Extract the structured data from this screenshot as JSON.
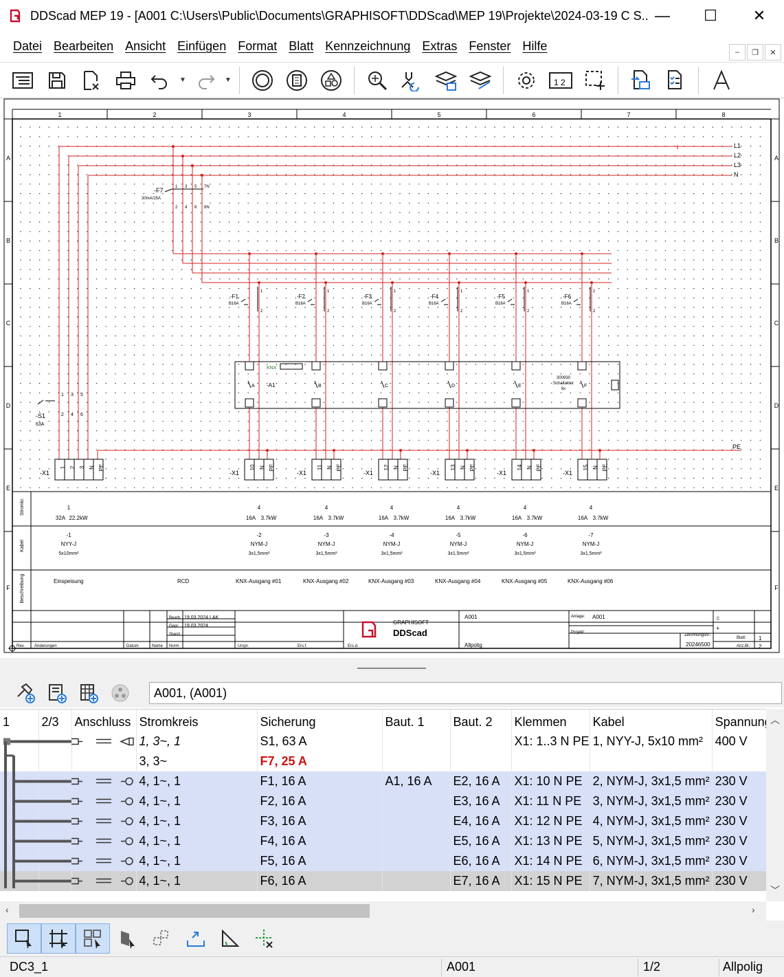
{
  "window": {
    "title": "DDScad MEP 19 - [A001  C:\\Users\\Public\\Documents\\GRAPHISOFT\\DDScad\\MEP 19\\Projekte\\2024-03-19 C S...",
    "minimize": "—",
    "maximize": "☐",
    "close": "✕"
  },
  "menu": [
    "Datei",
    "Bearbeiten",
    "Ansicht",
    "Einfügen",
    "Format",
    "Blatt",
    "Kennzeichnung",
    "Extras",
    "Fenster",
    "Hilfe"
  ],
  "toolbar": {
    "icons": [
      "document-list-icon",
      "save-icon",
      "close-document-icon",
      "print-icon",
      "undo-icon",
      "redo-icon",
      "circle-tool-icon",
      "component-icon",
      "symbols-icon",
      "zoom-icon",
      "select-transfer-icon",
      "layers-icon",
      "layers-off-icon",
      "settings-icon",
      "dimension-icon",
      "selection-move-icon",
      "export-doc-icon",
      "list-check-icon",
      "text-icon"
    ]
  },
  "drawing": {
    "columns": [
      "1",
      "2",
      "3",
      "4",
      "5",
      "6",
      "7",
      "8"
    ],
    "rows": [
      "A",
      "B",
      "C",
      "D",
      "E",
      "F"
    ],
    "buses": [
      "L1",
      "L2",
      "L3",
      "N"
    ],
    "pe_label": "PE",
    "rcd": {
      "label": "-F7",
      "rating": "30mA/25A",
      "top": [
        "1",
        "3",
        "5",
        "7N"
      ],
      "bottom": [
        "2",
        "4",
        "6",
        "8N"
      ]
    },
    "main_switch": {
      "label": "-S1",
      "rating": "63A",
      "top": [
        "1",
        "3",
        "5"
      ],
      "bottom": [
        "2",
        "4",
        "6"
      ]
    },
    "breakers": [
      {
        "label": "-F1",
        "rating": "B16A"
      },
      {
        "label": "-F2",
        "rating": "B16A"
      },
      {
        "label": "-F3",
        "rating": "B16A"
      },
      {
        "label": "-F4",
        "rating": "B16A"
      },
      {
        "label": "-F5",
        "rating": "B16A"
      },
      {
        "label": "-F6",
        "rating": "B16A"
      }
    ],
    "knx": {
      "label": "-A1",
      "channels": [
        "A",
        "B",
        "C",
        "D",
        "E",
        "F"
      ],
      "note1": "300930",
      "note2": "Schaltaktor",
      "note3": "6x",
      "knx": "KNX"
    },
    "terminals": [
      {
        "tag": "-X1",
        "pins": [
          "1",
          "2",
          "3",
          "N",
          "PE"
        ]
      },
      {
        "tag": "-X1",
        "pins": [
          "10",
          "N",
          "PE"
        ]
      },
      {
        "tag": "-X1",
        "pins": [
          "11",
          "N",
          "PE"
        ]
      },
      {
        "tag": "-X1",
        "pins": [
          "12",
          "N",
          "PE"
        ]
      },
      {
        "tag": "-X1",
        "pins": [
          "13",
          "N",
          "PE"
        ]
      },
      {
        "tag": "-X1",
        "pins": [
          "14",
          "N",
          "PE"
        ]
      },
      {
        "tag": "-X1",
        "pins": [
          "15",
          "N",
          "PE"
        ]
      }
    ],
    "table_rows": [
      "Stromkr.",
      "Kabel",
      "Beschreibung"
    ],
    "circuits": [
      {
        "nr": "1",
        "rating": "32A",
        "power": "22.2kW",
        "cable_nr": "-1",
        "cable": "NYY-J",
        "section": "5x10mm²",
        "desc": "Einspeisung"
      },
      {
        "nr": "4",
        "rating": "16A",
        "power": "3.7kW",
        "cable_nr": "-2",
        "cable": "NYM-J",
        "section": "3x1,5mm²",
        "desc": "KNX-Ausgang #01"
      },
      {
        "nr": "4",
        "rating": "16A",
        "power": "3.7kW",
        "cable_nr": "-3",
        "cable": "NYM-J",
        "section": "3x1,5mm²",
        "desc": "KNX-Ausgang #02"
      },
      {
        "nr": "4",
        "rating": "16A",
        "power": "3.7kW",
        "cable_nr": "-4",
        "cable": "NYM-J",
        "section": "3x1,5mm²",
        "desc": "KNX-Ausgang #03"
      },
      {
        "nr": "4",
        "rating": "16A",
        "power": "3.7kW",
        "cable_nr": "-5",
        "cable": "NYM-J",
        "section": "3x1,5mm²",
        "desc": "KNX-Ausgang #04"
      },
      {
        "nr": "4",
        "rating": "16A",
        "power": "3.7kW",
        "cable_nr": "-6",
        "cable": "NYM-J",
        "section": "3x1,5mm²",
        "desc": "KNX-Ausgang #05"
      },
      {
        "nr": "4",
        "rating": "16A",
        "power": "3.7kW",
        "cable_nr": "-7",
        "cable": "NYM-J",
        "section": "3x1,5mm²",
        "desc": "KNX-Ausgang #06"
      }
    ],
    "rcd_desc": "RCD",
    "titleblock": {
      "bearb": "Bearb",
      "bearb_val": "19.03.2024 LAK",
      "gepr": "Gepr",
      "gepr_val": "19.03.2024",
      "stand": "Stand",
      "rev": "Rev.",
      "aend": "Änderungen",
      "datum": "Datum",
      "name": "Name",
      "norm": "Norm",
      "urspr": "Urspr.",
      "ers_f": "Ers.f.",
      "ers_d": "Ers.d.",
      "brand1": "GRAPHISOFT",
      "brand2": "DDScad",
      "sheet_name": "A001",
      "allpolig": "Allpolig",
      "anlage_lbl": "Anlage:",
      "anlage": "A001",
      "projekt_lbl": "Projekt:",
      "zeichnung_lbl": "Zeichnungsnr.:",
      "zeichnung": "20246500",
      "blatt_lbl": "Blatt:",
      "blatt": "1",
      "anz_lbl": "Anz.Bl.:",
      "anz": "2",
      "eq": "=",
      "plus": "+"
    }
  },
  "panel": {
    "field_value": "A001,  (A001)",
    "icons": [
      "add-connection-icon",
      "add-panel-icon",
      "add-list-icon",
      "network-icon"
    ]
  },
  "table": {
    "headers": [
      "1",
      "2/3",
      "Anschluss",
      "Stromkreis",
      "Sicherung",
      "Baut. 1",
      "Baut. 2",
      "Klemmen",
      "Kabel",
      "Spannung"
    ],
    "rows": [
      {
        "stromkreis": "1, 3~, 1",
        "sicherung": "S1, 63 A",
        "baut1": "",
        "baut2": "",
        "klemmen": "X1: 1..3 N PE",
        "kabel": "1, NYY-J, 5x10 mm²",
        "spannung": "400 V",
        "style": "it"
      },
      {
        "stromkreis": "3, 3~",
        "sicherung": "F7, 25 A",
        "baut1": "",
        "baut2": "",
        "klemmen": "",
        "kabel": "",
        "spannung": "",
        "style": "red"
      },
      {
        "stromkreis": "4, 1~, 1",
        "sicherung": "F1, 16 A",
        "baut1": "A1, 16 A",
        "baut2": "E2, 16 A",
        "klemmen": "X1: 10 N PE",
        "kabel": "2, NYM-J, 3x1,5 mm²",
        "spannung": "230 V",
        "style": "sel"
      },
      {
        "stromkreis": "4, 1~, 1",
        "sicherung": "F2, 16 A",
        "baut1": "",
        "baut2": "E3, 16 A",
        "klemmen": "X1: 11 N PE",
        "kabel": "3, NYM-J, 3x1,5 mm²",
        "spannung": "230 V",
        "style": "sel"
      },
      {
        "stromkreis": "4, 1~, 1",
        "sicherung": "F3, 16 A",
        "baut1": "",
        "baut2": "E4, 16 A",
        "klemmen": "X1: 12 N PE",
        "kabel": "4, NYM-J, 3x1,5 mm²",
        "spannung": "230 V",
        "style": "sel"
      },
      {
        "stromkreis": "4, 1~, 1",
        "sicherung": "F4, 16 A",
        "baut1": "",
        "baut2": "E5, 16 A",
        "klemmen": "X1: 13 N PE",
        "kabel": "5, NYM-J, 3x1,5 mm²",
        "spannung": "230 V",
        "style": "sel"
      },
      {
        "stromkreis": "4, 1~, 1",
        "sicherung": "F5, 16 A",
        "baut1": "",
        "baut2": "E6, 16 A",
        "klemmen": "X1: 14 N PE",
        "kabel": "6, NYM-J, 3x1,5 mm²",
        "spannung": "230 V",
        "style": "sel"
      },
      {
        "stromkreis": "4, 1~, 1",
        "sicherung": "F6, 16 A",
        "baut1": "",
        "baut2": "E7, 16 A",
        "klemmen": "X1: 15 N PE",
        "kabel": "7, NYM-J, 3x1,5 mm²",
        "spannung": "230 V",
        "style": "cur"
      }
    ]
  },
  "bottom_tools": [
    "select-rect-icon",
    "select-points-icon",
    "select-group-icon",
    "select-object-icon",
    "move-icon",
    "export-icon",
    "angle-icon",
    "crosshair-delete-icon"
  ],
  "status": {
    "left": "DC3_1",
    "sheet": "A001",
    "page": "1/2",
    "mode": "Allpolig"
  },
  "colors": {
    "wire": "#d42020",
    "selected_row": "#d8e0f8",
    "current_row": "#d2d2d2",
    "brand": "#c8102e"
  }
}
